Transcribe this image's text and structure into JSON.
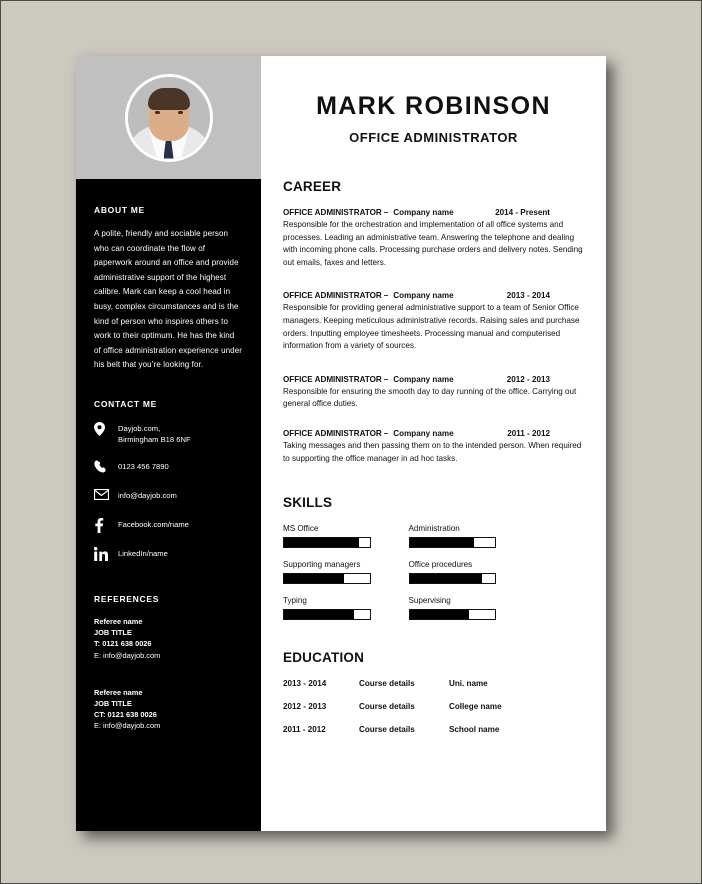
{
  "theme": {
    "page_background": "#ccc9bf",
    "sidebar_color": "#000000",
    "photo_band_color": "#c0c0c0",
    "sheet_color": "#ffffff",
    "text_color": "#111111"
  },
  "header": {
    "full_name": "MARK ROBINSON",
    "job_title": "OFFICE ADMINISTRATOR"
  },
  "sidebar": {
    "about": {
      "heading": "ABOUT ME",
      "text": "A polite, friendly and sociable person who can coordinate the flow of paperwork around an office and provide administrative support of the highest calibre. Mark can keep a cool head in busy, complex circumstances and is the kind of person who inspires others to work to their optimum. He has the kind of office administration experience under his belt that you’re looking for."
    },
    "contact": {
      "heading": "CONTACT ME",
      "items": [
        {
          "icon": "location-pin-icon",
          "line1": "Dayjob.com,",
          "line2": "Birmingham B18 6NF"
        },
        {
          "icon": "phone-icon",
          "line1": "0123 456 7890",
          "line2": ""
        },
        {
          "icon": "envelope-icon",
          "line1": "info@dayjob.com",
          "line2": ""
        },
        {
          "icon": "facebook-icon",
          "line1": "Facebook.com/name",
          "line2": ""
        },
        {
          "icon": "linkedin-icon",
          "line1": "LinkedIn/name",
          "line2": ""
        }
      ]
    },
    "references": {
      "heading": "REFERENCES",
      "items": [
        {
          "name": "Referee name",
          "job_title": "JOB TITLE",
          "phone": "T: 0121 638 0026",
          "email": "E: info@dayjob.com"
        },
        {
          "name": "Referee name",
          "job_title": "JOB TITLE",
          "phone": "CT: 0121 638 0026",
          "email": "E: info@dayjob.com"
        }
      ]
    }
  },
  "career": {
    "heading": "CAREER",
    "jobs": [
      {
        "role": "OFFICE ADMINISTRATOR",
        "dash": "–",
        "company": "Company name",
        "dates": "2014 - Present",
        "description": "Responsible for the orchestration and implementation of all office systems and processes. Leading an administrative team. Answering the telephone and dealing with incoming phone calls. Processing purchase orders and delivery notes. Sending out emails, faxes and letters."
      },
      {
        "role": "OFFICE ADMINISTRATOR",
        "dash": "–",
        "company": "Company name",
        "dates": "2013 - 2014",
        "description": "Responsible for providing general administrative support to a team of Senior Office managers. Keeping meticulous administrative records. Raising sales and purchase orders. Inputting employee timesheets. Processing manual and computerised information from a variety of sources."
      },
      {
        "role": "OFFICE ADMINISTRATOR",
        "dash": "–",
        "company": "Company name",
        "dates": "2012 - 2013",
        "description": "Responsible for ensuring the smooth day to day running of the office. Carrying out general office duties."
      },
      {
        "role": "OFFICE ADMINISTRATOR",
        "dash": "–",
        "company": "Company name",
        "dates": "2011 - 2012",
        "description": "Taking messages and then passing them on to the intended person.  When required to supporting the office manager in ad hoc tasks."
      }
    ]
  },
  "skills": {
    "heading": "SKILLS",
    "items": [
      {
        "label": "MS Office",
        "level": 88
      },
      {
        "label": "Administration",
        "level": 75
      },
      {
        "label": "Supporting managers",
        "level": 70
      },
      {
        "label": "Office procedures",
        "level": 85
      },
      {
        "label": "Typing",
        "level": 82
      },
      {
        "label": "Supervising",
        "level": 70
      }
    ]
  },
  "education": {
    "heading": "EDUCATION",
    "rows": [
      {
        "years": "2013 - 2014",
        "course": "Course details",
        "place": "Uni. name"
      },
      {
        "years": "2012 - 2013",
        "course": "Course details",
        "place": "College name"
      },
      {
        "years": "2011 - 2012",
        "course": "Course details",
        "place": "School name"
      }
    ]
  }
}
